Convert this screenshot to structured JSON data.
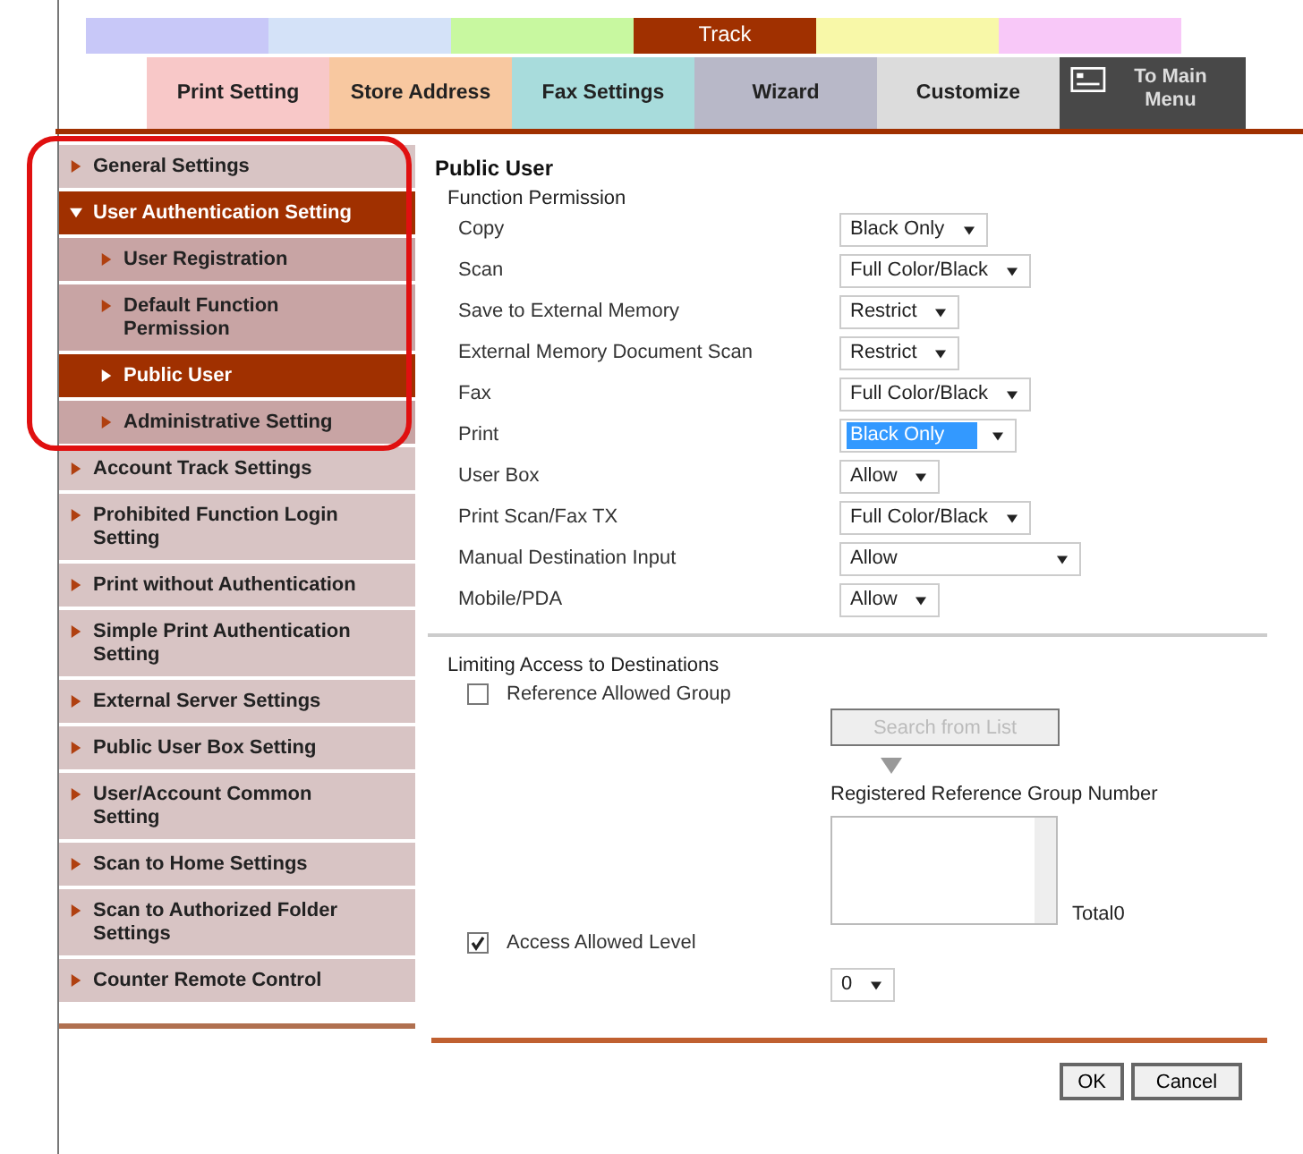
{
  "bands": [
    {
      "color": "#c8c8f8"
    },
    {
      "color": "#d4e2f8"
    },
    {
      "color": "#c8f8a0"
    },
    {
      "color": "#a03000",
      "label": "Track"
    },
    {
      "color": "#f8f8a8"
    },
    {
      "color": "#f8c8f8"
    }
  ],
  "tabs": [
    {
      "kind": "tab",
      "label": "Print Setting",
      "color": "#f8c8c8"
    },
    {
      "kind": "tab",
      "label": "Store Address",
      "color": "#f8c8a0"
    },
    {
      "kind": "tab",
      "label": "Fax Settings",
      "color": "#a8dcdc"
    },
    {
      "kind": "tab",
      "label": "Wizard",
      "color": "#b8b8c8"
    },
    {
      "kind": "tab",
      "label": "Customize",
      "color": "#dcdcdc"
    },
    {
      "kind": "menu",
      "label": "To Main Menu",
      "color": "#484848"
    }
  ],
  "sidebar": {
    "items": [
      {
        "label": "General Settings",
        "expanded": false
      },
      {
        "label": "User Authentication Setting",
        "expanded": true,
        "children": [
          {
            "label": "User Registration",
            "selected": false
          },
          {
            "label": "Default Function Permission",
            "selected": false
          },
          {
            "label": "Public User",
            "selected": true
          },
          {
            "label": "Administrative Setting",
            "selected": false
          }
        ]
      },
      {
        "label": "Account Track Settings",
        "expanded": false
      },
      {
        "label": "Prohibited Function Login Setting",
        "expanded": false
      },
      {
        "label": "Print without Authentication",
        "expanded": false
      },
      {
        "label": "Simple Print Authentication Setting",
        "expanded": false
      },
      {
        "label": "External Server Settings",
        "expanded": false
      },
      {
        "label": "Public User Box Setting",
        "expanded": false
      },
      {
        "label": "User/Account Common Setting",
        "expanded": false
      },
      {
        "label": "Scan to Home Settings",
        "expanded": false
      },
      {
        "label": "Scan to Authorized Folder Settings",
        "expanded": false
      },
      {
        "label": "Counter Remote Control",
        "expanded": false
      }
    ]
  },
  "panel": {
    "title": "Public User",
    "section": "Function Permission",
    "permissions": [
      {
        "label": "Copy",
        "value": "Black Only",
        "focused": false
      },
      {
        "label": "Scan",
        "value": "Full Color/Black",
        "focused": false
      },
      {
        "label": "Save to External Memory",
        "value": "Restrict",
        "focused": false
      },
      {
        "label": "External Memory Document Scan",
        "value": "Restrict",
        "focused": false
      },
      {
        "label": "Fax",
        "value": "Full Color/Black",
        "focused": false
      },
      {
        "label": "Print",
        "value": "Black Only",
        "focused": true
      },
      {
        "label": "User Box",
        "value": "Allow",
        "focused": false
      },
      {
        "label": "Print Scan/Fax TX",
        "value": "Full Color/Black",
        "focused": false
      },
      {
        "label": "Manual Destination Input",
        "value": "Allow",
        "focused": false
      },
      {
        "label": "Mobile/PDA",
        "value": "Allow",
        "focused": false
      }
    ]
  },
  "limiting": {
    "title": "Limiting Access to Destinations",
    "reference_group": {
      "label": "Reference Allowed Group",
      "checked": false
    },
    "search_button": {
      "label": "Search from List",
      "disabled": true
    },
    "registered_label": "Registered Reference Group Number",
    "total": "Total0",
    "access_level": {
      "label": "Access Allowed Level",
      "checked": true
    },
    "level_value": "0"
  },
  "buttons": [
    "OK",
    "Cancel"
  ]
}
